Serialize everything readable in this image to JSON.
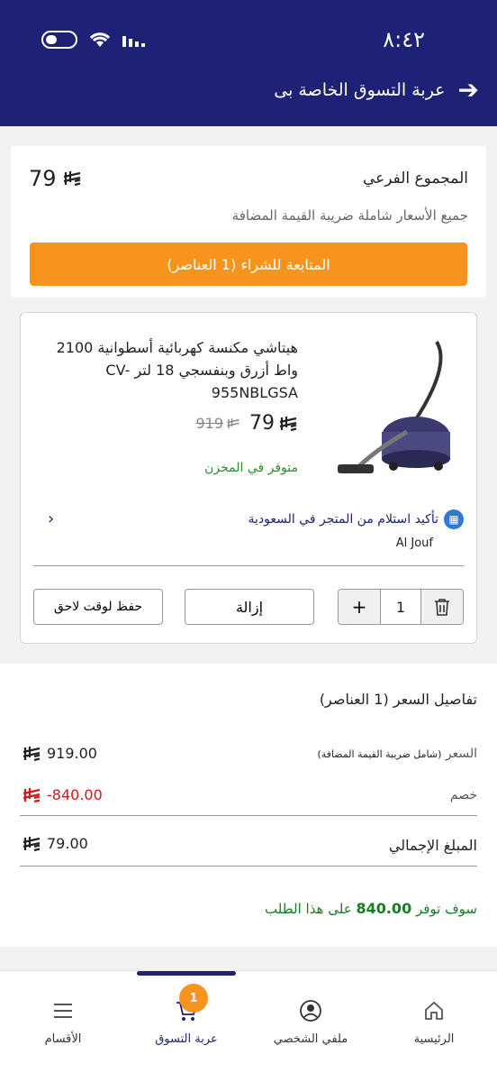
{
  "status_bar": {
    "time": "٨:٤٢"
  },
  "header": {
    "title": "عربة التسوق الخاصة بى"
  },
  "summary": {
    "subtotal_label": "المجموع الفرعي",
    "subtotal_value": "79",
    "vat_note": "جميع الأسعار شاملة ضريبة القيمة المضافة",
    "checkout_label": "المتابعة للشراء (1 العناصر)"
  },
  "product": {
    "name": "هيتاشي مكنسة كهربائية أسطوانية 2100 واط أزرق وبنفسجي 18 لتر CV-955NBLGSA",
    "price": "79",
    "old_price": "919",
    "stock": "متوفر في المخزن",
    "pickup": "تأكيد استلام من المتجر في السعودية",
    "location": "Al Jouf",
    "quantity": "1",
    "remove_label": "إزالة",
    "save_later_label": "حفظ لوقت لاحق",
    "plus_label": "+"
  },
  "price_details": {
    "title": "تفاصيل السعر (1 العناصر)",
    "price_label": "السعر",
    "price_note": "(شامل ضريبة القيمة المضافة)",
    "price_value": "919.00",
    "discount_label": "خصم",
    "discount_value": "-840.00",
    "total_label": "المبلغ الإجمالي",
    "total_value": "79.00",
    "savings_prefix": "سوف توفر",
    "savings_amount": "840.00",
    "savings_suffix": "على هذا الطلب"
  },
  "bottom_nav": {
    "items": [
      {
        "label": "الرئيسية",
        "icon": "home-icon"
      },
      {
        "label": "ملفي الشخصي",
        "icon": "profile-icon"
      },
      {
        "label": "عربة التسوق",
        "icon": "cart-icon",
        "badge": "1"
      },
      {
        "label": "الأقسام",
        "icon": "menu-icon"
      }
    ]
  },
  "colors": {
    "brand": "#1d2277",
    "accent": "#f7941d",
    "discount": "#d21a1a",
    "savings": "#137f23"
  }
}
